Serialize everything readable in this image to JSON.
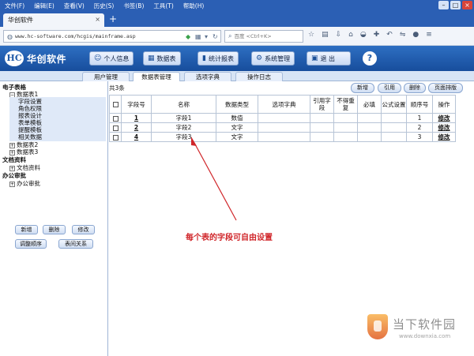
{
  "browser": {
    "menu": [
      "文件(F)",
      "编辑(E)",
      "查看(V)",
      "历史(S)",
      "书签(B)",
      "工具(T)",
      "帮助(H)"
    ],
    "tab_title": "华创软件",
    "url": "www.hc-software.com/hcgis/mainframe.asp",
    "search_placeholder": "百度 <Ctrl+K>"
  },
  "app": {
    "logo_mark": "HC",
    "logo_text": "华创软件",
    "header_buttons": {
      "personal": "个人信息",
      "datatable": "数据表",
      "report": "统计报表",
      "system": "系统管理",
      "exit": "退 出",
      "help": "?"
    },
    "subtabs": [
      "用户管理",
      "数据表管理",
      "选项字典",
      "操作日志"
    ]
  },
  "sidebar": {
    "groups": {
      "ebook": "电子表格",
      "table1": "数据表1",
      "field_settings": "字段设置",
      "role_perm": "角色权限",
      "report_design": "报表设计",
      "form_template": "表单模板",
      "reminder_template": "提醒模板",
      "related_data": "相关数据",
      "table2": "数据表2",
      "table3": "数据表3",
      "doc": "文档资料",
      "doc_item": "文档资料",
      "office": "办公审批",
      "office_item": "办公审批"
    },
    "buttons": {
      "add": "新增",
      "delete": "删除",
      "edit": "修改",
      "reorder": "调整顺序",
      "relation": "表间关系"
    }
  },
  "main": {
    "count": "共3条",
    "actions": {
      "add": "新增",
      "reference": "引用",
      "delete": "删除",
      "page_layout": "页面排版"
    },
    "columns": {
      "field_no": "字段号",
      "name": "名称",
      "type": "数据类型",
      "dict": "选项字典",
      "ref_field": "引用字段",
      "no_repeat": "不得重复",
      "required": "必填",
      "formula": "公式设置",
      "order": "顺序号",
      "op": "操作"
    },
    "rows": [
      {
        "no": "1",
        "name": "字段1",
        "type": "数值",
        "order": "1",
        "op": "修改"
      },
      {
        "no": "2",
        "name": "字段2",
        "type": "文字",
        "order": "2",
        "op": "修改"
      },
      {
        "no": "4",
        "name": "字段3",
        "type": "文字",
        "order": "3",
        "op": "修改"
      }
    ]
  },
  "annotation": "每个表的字段可自由设置",
  "watermark": {
    "text": "当下软件园",
    "url": "www.downxia.com"
  },
  "colors": {
    "menubar": "#2b5fb4",
    "header": "#1f5aa8",
    "annotation": "#d0262a"
  }
}
